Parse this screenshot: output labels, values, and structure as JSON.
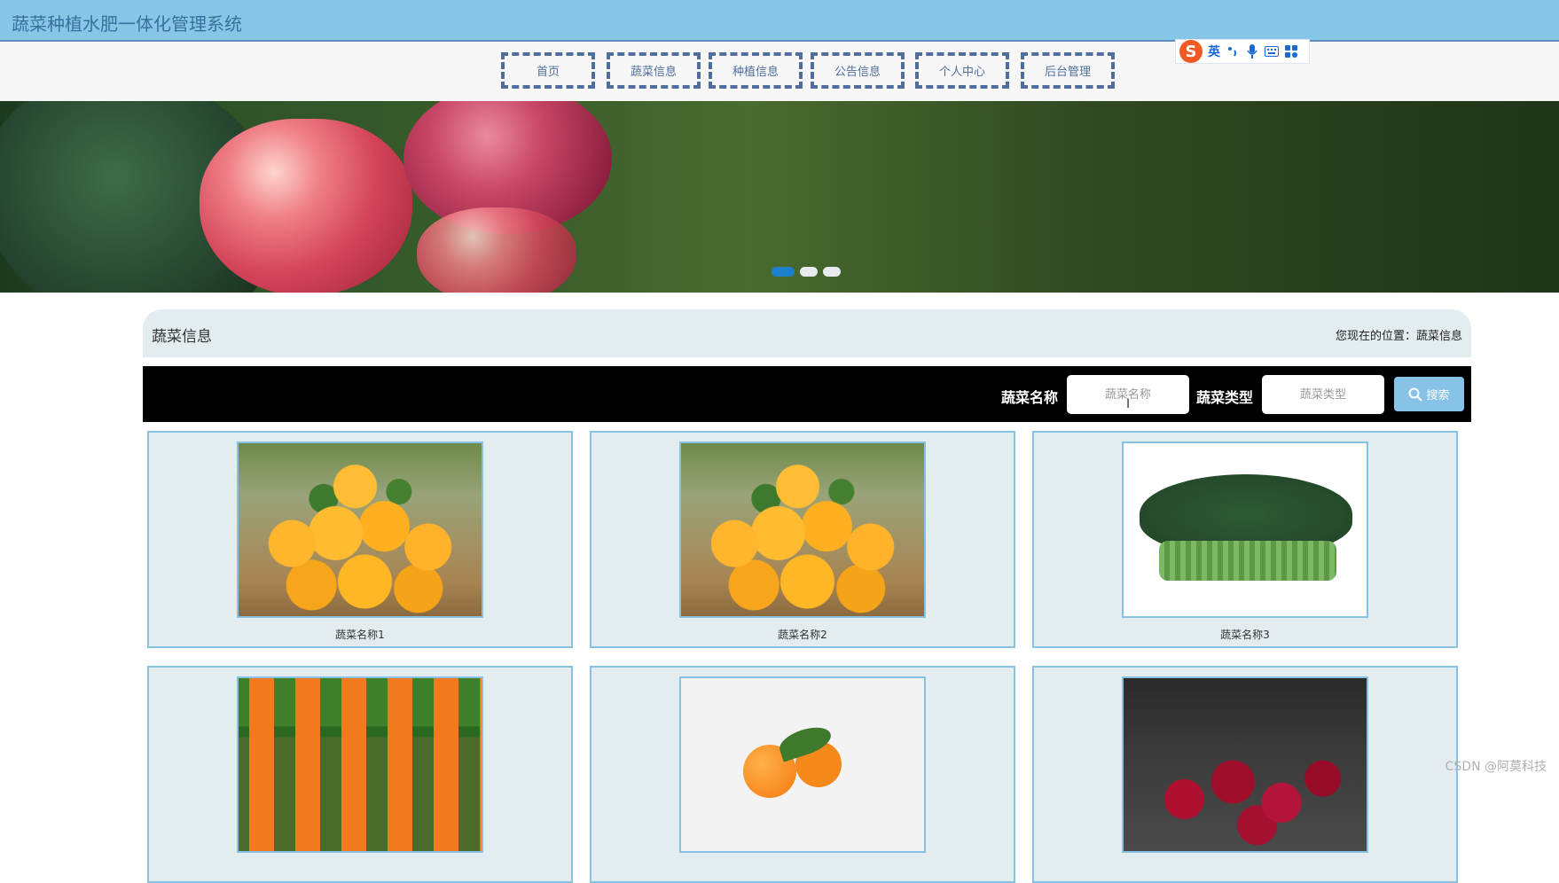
{
  "app": {
    "title": "蔬菜种植水肥一体化管理系统"
  },
  "nav": {
    "items": [
      {
        "label": "首页"
      },
      {
        "label": "蔬菜信息"
      },
      {
        "label": "种植信息"
      },
      {
        "label": "公告信息"
      },
      {
        "label": "个人中心"
      },
      {
        "label": "后台管理"
      }
    ]
  },
  "ime": {
    "lang_label": "英",
    "logo_letter": "S"
  },
  "carousel": {
    "slide_count": 3,
    "active_index": 0,
    "accent_color": "#1e7fcf"
  },
  "section": {
    "title": "蔬菜信息",
    "breadcrumb_prefix": "您现在的位置：",
    "breadcrumb_current": "蔬菜信息"
  },
  "search": {
    "name_label": "蔬菜名称",
    "name_placeholder": "蔬菜名称",
    "type_label": "蔬菜类型",
    "type_placeholder": "蔬菜类型",
    "button_label": "搜索"
  },
  "products": [
    {
      "name": "蔬菜名称1",
      "image": "oranges"
    },
    {
      "name": "蔬菜名称2",
      "image": "oranges"
    },
    {
      "name": "蔬菜名称3",
      "image": "leafy-greens"
    },
    {
      "name": "",
      "image": "carrots"
    },
    {
      "name": "",
      "image": "mandarin-oranges"
    },
    {
      "name": "",
      "image": "cherries"
    }
  ],
  "watermark": "CSDN @阿莫科技",
  "colors": {
    "topbar": "#87c6e6",
    "nav_border": "#4f6e9e",
    "card_border": "#87c1e4",
    "search_button": "#86c3e6"
  }
}
